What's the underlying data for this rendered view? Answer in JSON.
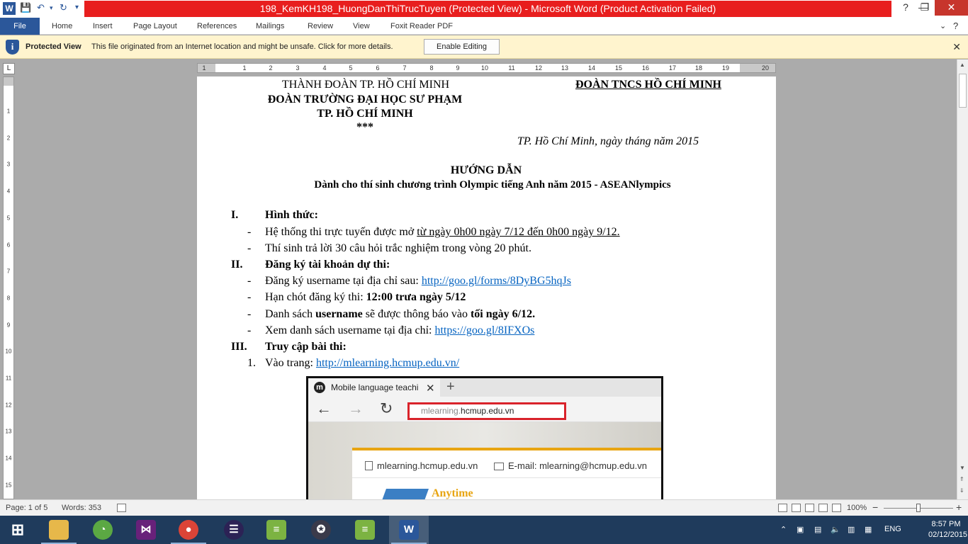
{
  "title_bar": {
    "title": "198_KemKH198_HuongDanThiTrucTuyen (Protected View)  -  Microsoft Word (Product Activation Failed)",
    "help_symbol": "?",
    "minimize_symbol": "—",
    "restore_symbol": "❐",
    "close_symbol": "✕"
  },
  "ribbon": {
    "tabs": [
      "File",
      "Home",
      "Insert",
      "Page Layout",
      "References",
      "Mailings",
      "Review",
      "View",
      "Foxit Reader PDF"
    ]
  },
  "protected_view": {
    "label": "Protected View",
    "message": "This file originated from an Internet location and might be unsafe. Click for more details.",
    "button": "Enable Editing"
  },
  "ruler": {
    "h_numbers": [
      "1",
      "1",
      "2",
      "3",
      "4",
      "5",
      "6",
      "7",
      "8",
      "9",
      "10",
      "11",
      "12",
      "13",
      "14",
      "15",
      "16",
      "17",
      "18",
      "19",
      "20"
    ],
    "v_numbers": [
      "1",
      "2",
      "3",
      "4",
      "5",
      "6",
      "7",
      "8",
      "9",
      "10",
      "11",
      "12",
      "13",
      "14",
      "15"
    ]
  },
  "document": {
    "header_left_1": "THÀNH ĐOÀN TP. HỒ CHÍ MINH",
    "header_left_2": "ĐOÀN TRƯỜNG ĐẠI HỌC SƯ PHẠM",
    "header_left_3": "TP. HỒ CHÍ MINH",
    "header_left_4": "***",
    "header_right": "ĐOÀN TNCS HỒ CHÍ MINH",
    "date_line": "TP. Hồ Chí Minh, ngày     tháng     năm 2015",
    "title": "HƯỚNG DẪN",
    "subtitle": "Dành cho thí sinh chương trình Olympic tiếng Anh năm 2015 - ASEANlympics",
    "s1_num": "I.",
    "s1_title": "Hình thức:",
    "s1_b1_a": "Hệ thống thi trực tuyến được mở ",
    "s1_b1_b": "từ ngày 0h00 ngày 7/12 đến 0h00 ngày 9/12.",
    "s1_b2": "Thí sinh trả lời 30 câu hỏi trắc nghiệm trong vòng 20 phút.",
    "s2_num": "II.",
    "s2_title": "Đăng ký tài khoản dự thi:",
    "s2_b1_a": "Đăng ký username tại địa chỉ sau: ",
    "s2_b1_link": "http://goo.gl/forms/8DyBG5hqJs",
    "s2_b2_a": "Hạn chót đăng ký thi: ",
    "s2_b2_b": "12:00 trưa ngày 5/12",
    "s2_b3_a": "Danh sách ",
    "s2_b3_b": "username",
    "s2_b3_c": " sẽ được thông báo vào ",
    "s2_b3_d": "tối ngày 6/12.",
    "s2_b4_a": "Xem danh sách username tại địa chỉ: ",
    "s2_b4_link": "https://goo.gl/8IFXOs",
    "s3_num": "III.",
    "s3_title": "Truy cập bài thi:",
    "s3_i1_num": "1.",
    "s3_i1_a": "Vào trang: ",
    "s3_i1_link": "http://mlearning.hcmup.edu.vn/",
    "bullet": "-"
  },
  "embedded_browser": {
    "tab_title": "Mobile language teachi",
    "tab_close": "✕",
    "new_tab": "+",
    "logo_letter": "m",
    "back": "←",
    "forward": "→",
    "refresh": "↻",
    "address_dim": "mlearning.",
    "address_main": "hcmup.edu.vn",
    "site_link": "mlearning.hcmup.edu.vn",
    "email_label": "E-mail: ",
    "email_value": "mlearning@hcmup.edu.vn",
    "anytime": "Anytime"
  },
  "status_bar": {
    "page": "Page: 1 of 5",
    "words": "Words: 353",
    "zoom": "100%",
    "zoom_minus": "−",
    "zoom_plus": "+"
  },
  "taskbar": {
    "language": "ENG",
    "time": "8:57 PM",
    "date": "02/12/2015"
  },
  "colors": {
    "title_red": "#E81E1E",
    "word_blue": "#2B579A",
    "link_blue": "#0563C1",
    "protected_bar": "#FFF4CE",
    "taskbar": "#1F3B5C"
  }
}
